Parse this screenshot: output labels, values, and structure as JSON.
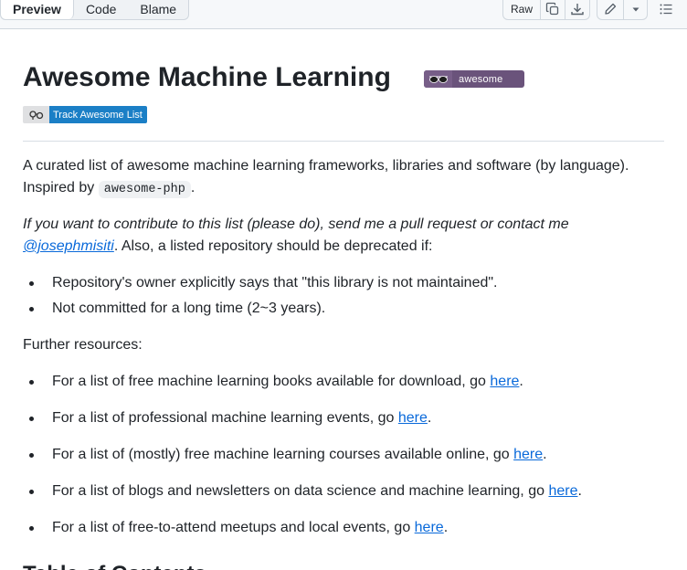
{
  "toolbar": {
    "tabs": [
      "Preview",
      "Code",
      "Blame"
    ],
    "raw_label": "Raw"
  },
  "readme": {
    "title": "Awesome Machine Learning",
    "badge_awesome": "awesome",
    "badge_track": "Track Awesome List",
    "intro_text": "A curated list of awesome machine learning frameworks, libraries and software (by language). Inspired by",
    "intro_code": "awesome-php",
    "intro_end": ".",
    "contrib_italic": "If you want to contribute to this list (please do), send me a pull request or contact me",
    "contrib_link": "@josephmisiti",
    "contrib_rest": ". Also, a listed repository should be deprecated if:",
    "deprecation_items": [
      "Repository's owner explicitly says that \"this library is not maintained\".",
      "Not committed for a long time (2~3 years)."
    ],
    "further_label": "Further resources:",
    "resources": [
      {
        "text": "For a list of free machine learning books available for download, go ",
        "link": "here",
        "end": "."
      },
      {
        "text": "For a list of professional machine learning events, go ",
        "link": "here",
        "end": "."
      },
      {
        "text": "For a list of (mostly) free machine learning courses available online, go ",
        "link": "here",
        "end": "."
      },
      {
        "text": "For a list of blogs and newsletters on data science and machine learning, go ",
        "link": "here",
        "end": "."
      },
      {
        "text": "For a list of free-to-attend meetups and local events, go ",
        "link": "here",
        "end": "."
      }
    ],
    "toc_heading": "Table of Contents"
  },
  "icons": [
    "copy-icon",
    "download-icon",
    "pencil-icon",
    "triangle-down-icon",
    "list-unordered-icon",
    "glasses-icon",
    "track-logo-icon"
  ],
  "colors": {
    "link": "#0969da",
    "awesome_badge": "#6a537b",
    "track_badge": "#1b7fc6"
  }
}
